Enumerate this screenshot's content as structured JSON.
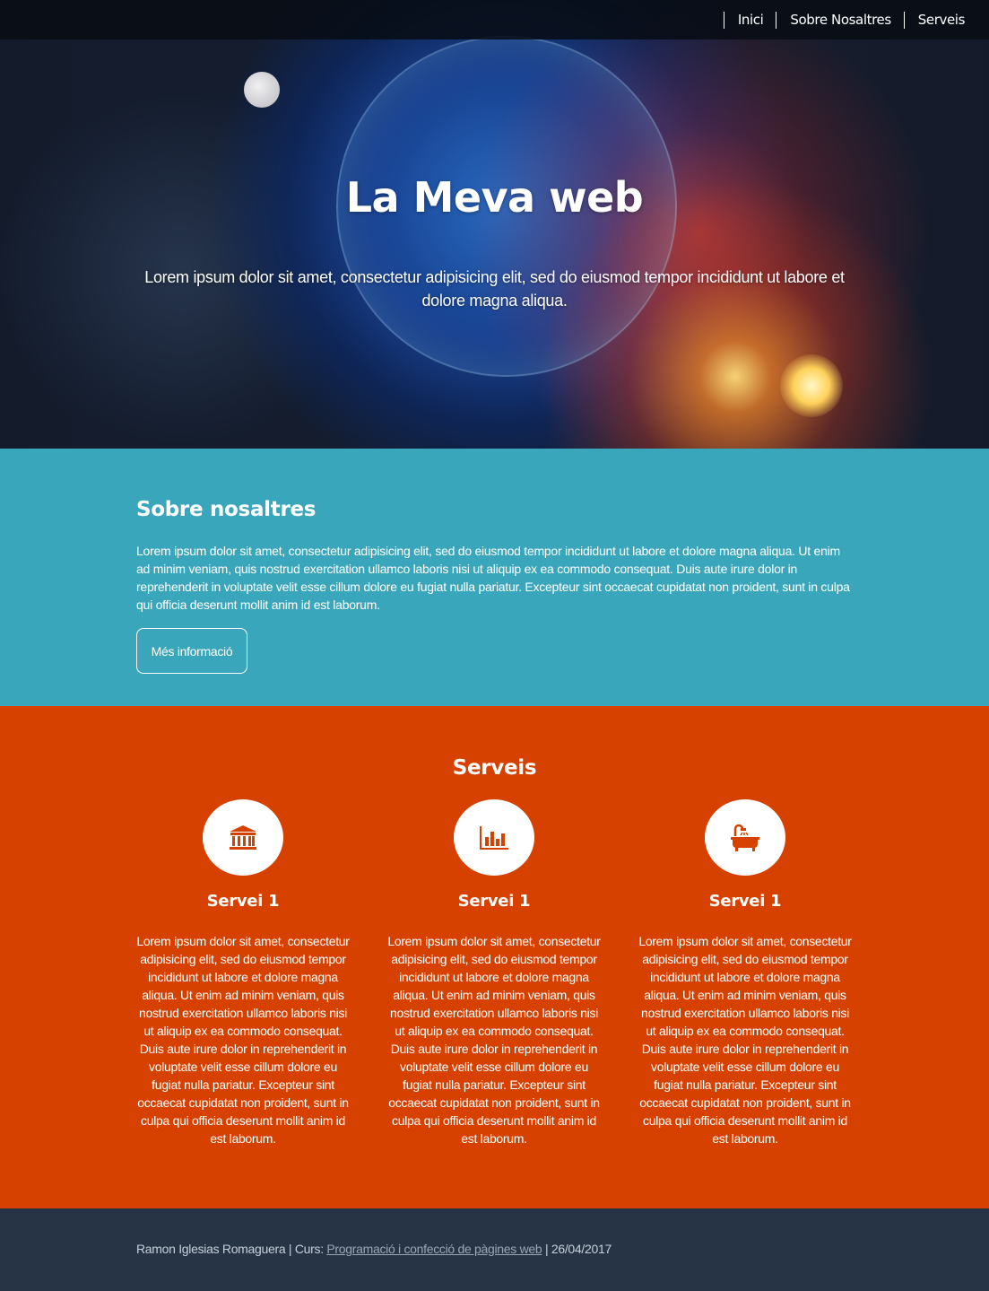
{
  "nav": {
    "items": [
      {
        "label": "Inici"
      },
      {
        "label": "Sobre Nosaltres"
      },
      {
        "label": "Serveis"
      }
    ]
  },
  "hero": {
    "title": "La Meva web",
    "subtitle": "Lorem ipsum dolor sit amet, consectetur adipisicing elit, sed do eiusmod tempor incididunt ut labore et dolore magna aliqua."
  },
  "about": {
    "title": "Sobre nosaltres",
    "text": "Lorem ipsum dolor sit amet, consectetur adipisicing elit, sed do eiusmod tempor incididunt ut labore et dolore magna aliqua. Ut enim ad minim veniam, quis nostrud exercitation ullamco laboris nisi ut aliquip ex ea commodo consequat. Duis aute irure dolor in reprehenderit in voluptate velit esse cillum dolore eu fugiat nulla pariatur. Excepteur sint occaecat cupidatat non proident, sunt in culpa qui officia deserunt mollit anim id est laborum.",
    "button_label": "Més informació"
  },
  "services": {
    "title": "Serveis",
    "items": [
      {
        "icon": "bank-icon",
        "title": "Servei 1",
        "text": "Lorem ipsum dolor sit amet, consectetur adipisicing elit, sed do eiusmod tempor incididunt ut labore et dolore magna aliqua. Ut enim ad minim veniam, quis nostrud exercitation ullamco laboris nisi ut aliquip ex ea commodo consequat. Duis aute irure dolor in reprehenderit in voluptate velit esse cillum dolore eu fugiat nulla pariatur. Excepteur sint occaecat cupidatat non proident, sunt in culpa qui officia deserunt mollit anim id est laborum."
      },
      {
        "icon": "bar-chart-icon",
        "title": "Servei 1",
        "text": "Lorem ipsum dolor sit amet, consectetur adipisicing elit, sed do eiusmod tempor incididunt ut labore et dolore magna aliqua. Ut enim ad minim veniam, quis nostrud exercitation ullamco laboris nisi ut aliquip ex ea commodo consequat. Duis aute irure dolor in reprehenderit in voluptate velit esse cillum dolore eu fugiat nulla pariatur. Excepteur sint occaecat cupidatat non proident, sunt in culpa qui officia deserunt mollit anim id est laborum."
      },
      {
        "icon": "bathtub-icon",
        "title": "Servei 1",
        "text": "Lorem ipsum dolor sit amet, consectetur adipisicing elit, sed do eiusmod tempor incididunt ut labore et dolore magna aliqua. Ut enim ad minim veniam, quis nostrud exercitation ullamco laboris nisi ut aliquip ex ea commodo consequat. Duis aute irure dolor in reprehenderit in voluptate velit esse cillum dolore eu fugiat nulla pariatur. Excepteur sint occaecat cupidatat non proident, sunt in culpa qui officia deserunt mollit anim id est laborum."
      }
    ]
  },
  "footer": {
    "prefix": "Ramon Iglesias Romaguera | Curs: ",
    "link_label": "Programació i confecció de pàgines web",
    "suffix": " | 26/04/2017"
  },
  "colors": {
    "about_bg": "#3aa6bb",
    "services_bg": "#d64100",
    "footer_bg": "#263445",
    "nav_bg": "#080c14"
  }
}
